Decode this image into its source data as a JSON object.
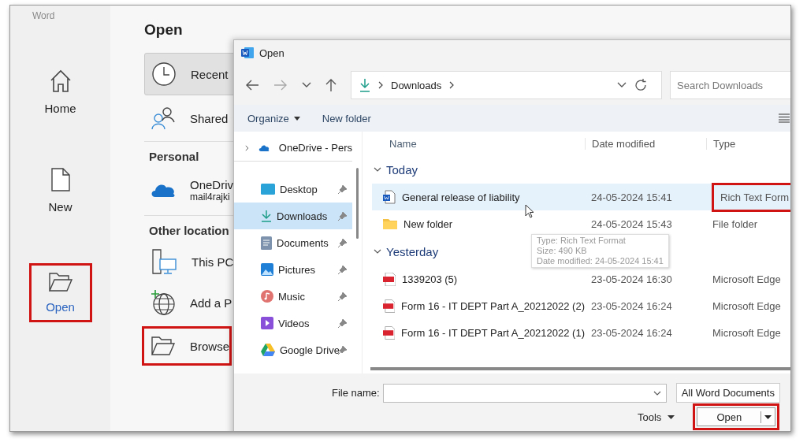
{
  "app": {
    "name": "Word"
  },
  "nav": [
    {
      "label": "Home",
      "selected": false,
      "highlighted": false
    },
    {
      "label": "New",
      "selected": false,
      "highlighted": false
    },
    {
      "label": "Open",
      "selected": true,
      "highlighted": true
    }
  ],
  "open_pane": {
    "title": "Open",
    "items": [
      {
        "kind": "item",
        "label": "Recent",
        "selected": true,
        "highlighted": false
      },
      {
        "kind": "item",
        "label": "Shared",
        "selected": false,
        "highlighted": false
      },
      {
        "kind": "heading",
        "label": "Personal"
      },
      {
        "kind": "account",
        "label": "OneDriv",
        "sublabel": "mail4rajki",
        "selected": false,
        "highlighted": false
      },
      {
        "kind": "heading",
        "label": "Other location"
      },
      {
        "kind": "item",
        "label": "This PC",
        "selected": false,
        "highlighted": false
      },
      {
        "kind": "item",
        "label": "Add a P",
        "selected": false,
        "highlighted": false
      },
      {
        "kind": "item",
        "label": "Browse",
        "selected": false,
        "highlighted": true
      }
    ]
  },
  "dialog": {
    "title": "Open",
    "path": [
      "Downloads"
    ],
    "search": {
      "placeholder": "Search Downloads"
    },
    "toolbar": {
      "organize": "Organize",
      "new_folder": "New folder"
    },
    "tree": [
      {
        "label": "OneDrive - Pers",
        "expandable": true,
        "pinned": false,
        "selected": false
      },
      {
        "label": "Desktop",
        "expandable": false,
        "pinned": true,
        "selected": false
      },
      {
        "label": "Downloads",
        "expandable": false,
        "pinned": true,
        "selected": true
      },
      {
        "label": "Documents",
        "expandable": false,
        "pinned": true,
        "selected": false
      },
      {
        "label": "Pictures",
        "expandable": false,
        "pinned": true,
        "selected": false
      },
      {
        "label": "Music",
        "expandable": false,
        "pinned": true,
        "selected": false
      },
      {
        "label": "Videos",
        "expandable": false,
        "pinned": true,
        "selected": false
      },
      {
        "label": "Google Drive",
        "expandable": false,
        "pinned": true,
        "selected": false
      }
    ],
    "columns": [
      "Name",
      "Date modified",
      "Type"
    ],
    "groups": [
      {
        "label": "Today",
        "files": [
          {
            "name": "General release of liability",
            "kind": "document",
            "date": "24-05-2024 15:41",
            "type": "Rich Text Form",
            "selected": true,
            "type_highlighted": true
          },
          {
            "name": "New folder",
            "kind": "folder",
            "date": "24-05-2024 15:43",
            "type": "File folder",
            "selected": false,
            "type_highlighted": false
          }
        ]
      },
      {
        "label": "Yesterday",
        "files": [
          {
            "name": "1339203 (5)",
            "kind": "pdf",
            "date": "23-05-2024 16:30",
            "type": "Microsoft Edge",
            "selected": false,
            "type_highlighted": false
          },
          {
            "name": "Form 16 - IT DEPT Part A_20212022 (2)",
            "kind": "pdf",
            "date": "23-05-2024 16:24",
            "type": "Microsoft Edge",
            "selected": false,
            "type_highlighted": false
          },
          {
            "name": "Form 16 - IT DEPT Part A_20212022 (1)",
            "kind": "pdf",
            "date": "23-05-2024 16:24",
            "type": "Microsoft Edge",
            "selected": false,
            "type_highlighted": false
          }
        ]
      }
    ],
    "tooltip": [
      "Type: Rich Text Format",
      "Size: 490 KB",
      "Date modified: 24-05-2024 15:41"
    ],
    "file_name": {
      "label": "File name:"
    },
    "file_type": "All Word Documents",
    "tools": "Tools",
    "open_button": {
      "label": "Open",
      "highlighted": true
    }
  }
}
